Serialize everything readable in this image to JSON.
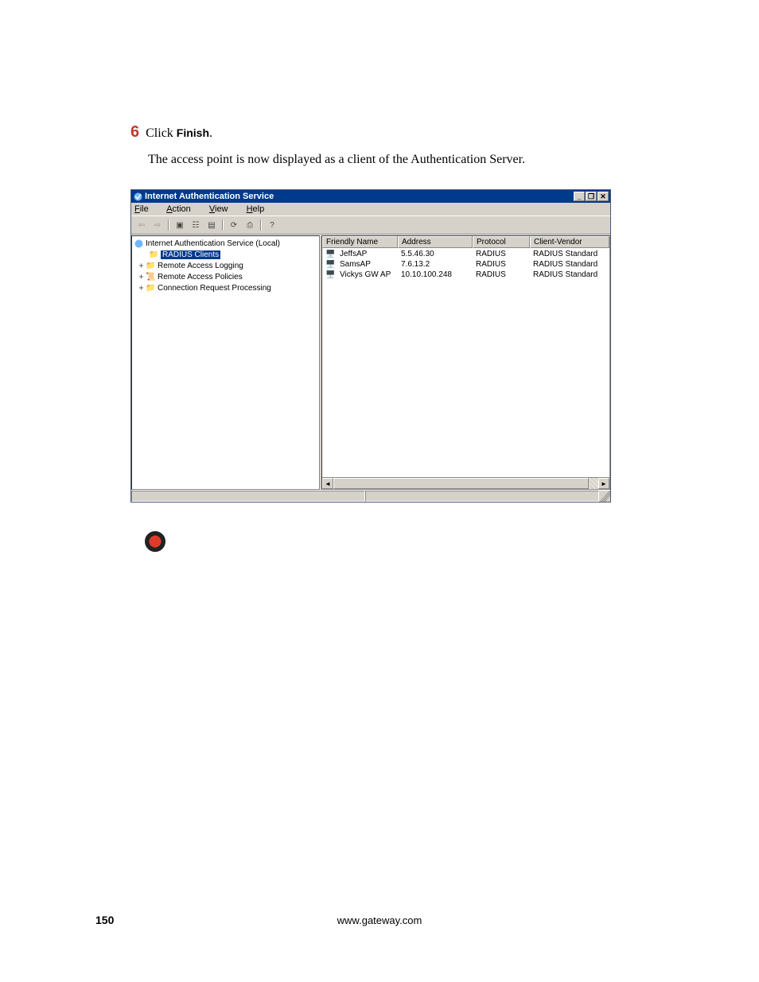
{
  "step": {
    "number": "6",
    "prefix": "Click ",
    "bold": "Finish",
    "suffix": "."
  },
  "description": "The access point is now displayed as a client of the Authentication Server.",
  "window": {
    "title": "Internet Authentication Service",
    "controls": {
      "min": "_",
      "max": "❐",
      "close": "✕"
    },
    "menu": {
      "file": "File",
      "action": "Action",
      "view": "View",
      "help": "Help"
    },
    "toolbar": {
      "back": "⇦",
      "forward": "⇨",
      "up": "▣",
      "list": "☷",
      "prop": "▤",
      "refresh": "⟳",
      "export": "⎙",
      "help": "?"
    },
    "tree": {
      "root": "Internet Authentication Service (Local)",
      "items": [
        {
          "label": "RADIUS Clients",
          "selected": true,
          "expander": ""
        },
        {
          "label": "Remote Access Logging",
          "selected": false,
          "expander": "+"
        },
        {
          "label": "Remote Access Policies",
          "selected": false,
          "expander": "+"
        },
        {
          "label": "Connection Request Processing",
          "selected": false,
          "expander": "+"
        }
      ]
    },
    "list": {
      "headers": [
        "Friendly Name",
        "Address",
        "Protocol",
        "Client-Vendor"
      ],
      "rows": [
        {
          "name": "JeffsAP",
          "address": "5.5.46.30",
          "protocol": "RADIUS",
          "vendor": "RADIUS Standard"
        },
        {
          "name": "SamsAP",
          "address": "7.6.13.2",
          "protocol": "RADIUS",
          "vendor": "RADIUS Standard"
        },
        {
          "name": "Vickys GW AP",
          "address": "10.10.100.248",
          "protocol": "RADIUS",
          "vendor": "RADIUS Standard"
        }
      ]
    },
    "scroll": {
      "left": "◄",
      "right": "►"
    }
  },
  "footer": {
    "url": "www.gateway.com",
    "page": "150"
  }
}
